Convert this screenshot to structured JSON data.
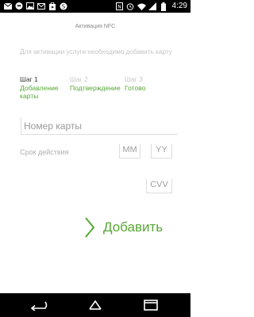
{
  "status_bar": {
    "time": "4:29",
    "left_icons": [
      "gmail-icon",
      "hangouts-icon",
      "image-icon",
      "mail-icon",
      "play-store-icon",
      "skype-icon"
    ],
    "right_icons": [
      "nfc-icon",
      "alarm-icon",
      "wifi-icon",
      "signal-icon",
      "battery-icon"
    ]
  },
  "header": {
    "title": "Активация NFC"
  },
  "hint": "Для активации услуги необходимо добавить карту",
  "steps": [
    {
      "number": "Шаг 1",
      "description": "Добавление карты"
    },
    {
      "number": "Шаг 2",
      "description": "Подтверждение"
    },
    {
      "number": "Шаг 3",
      "description": "Готово"
    }
  ],
  "form": {
    "card_number_placeholder": "Номер карты",
    "expiry_label": "Срок действия",
    "month_placeholder": "MM",
    "year_placeholder": "YY",
    "cvv_placeholder": "CVV"
  },
  "add_button": {
    "label": "Добавить"
  },
  "nav_bar": {
    "icons": [
      "back-icon",
      "home-icon",
      "recents-icon"
    ]
  },
  "colors": {
    "accent": "#57a835",
    "status_bar": "#000000",
    "background": "#ffffff"
  }
}
